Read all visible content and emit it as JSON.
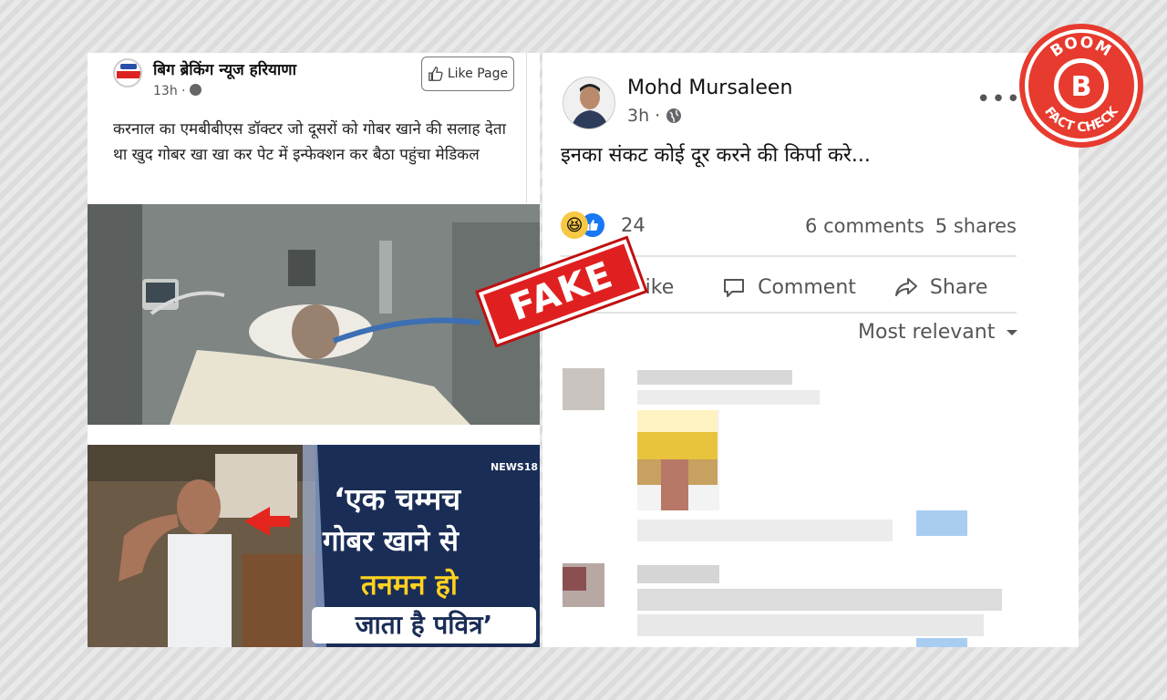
{
  "left_post": {
    "page_name": "बिग ब्रेकिंग न्यूज हरियाणा",
    "time": "13h ·",
    "like_page_label": "Like Page",
    "caption": "करनाल का एमबीबीएस डॉक्टर जो दूसरों को गोबर खाने की सलाह देता था खुद गोबर खा खा कर पेट में इन्फेक्शन कर बैठा पहुंचा मेडिकल",
    "news_overlay": {
      "channel": "NEWS18",
      "line1": "‘एक चम्मच",
      "line2": "गोबर खाने से",
      "line3": "तनमन हो",
      "line4": "जाता है पवित्र’"
    }
  },
  "fake_stamp": "FAKE",
  "right_post": {
    "author": "Mohd Mursaleen",
    "time": "3h ·",
    "text": "इनका संकट कोई दूर करने की किर्पा करे...",
    "reaction_count": "24",
    "comments": "6 comments",
    "shares": "5 shares",
    "actions": {
      "like": "Like",
      "comment": "Comment",
      "share": "Share"
    },
    "sort_label": "Most relevant"
  },
  "badge": {
    "top": "BOOM",
    "letter": "B",
    "bottom": "FACT CHECK"
  },
  "colors": {
    "accent_red": "#e02020",
    "fb_blue": "#1877f2"
  }
}
